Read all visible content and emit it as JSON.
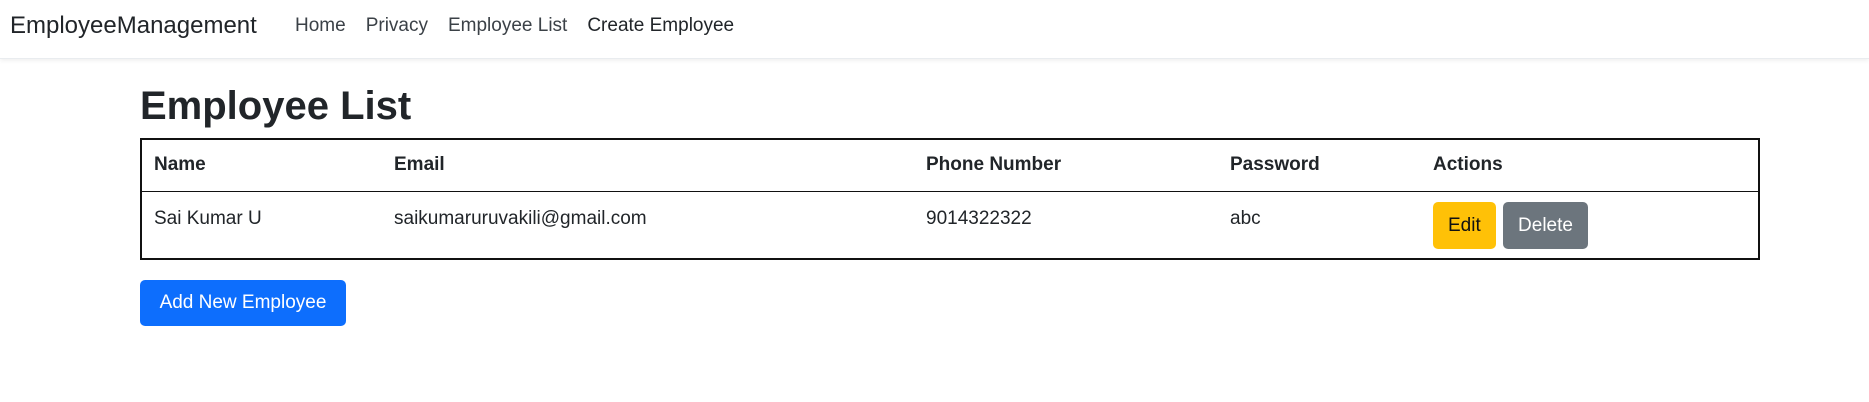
{
  "navbar": {
    "brand": "EmployeeManagement",
    "links": [
      "Home",
      "Privacy",
      "Employee List",
      "Create Employee"
    ]
  },
  "page": {
    "title": "Employee List"
  },
  "table": {
    "headers": [
      "Name",
      "Email",
      "Phone Number",
      "Password",
      "Actions"
    ],
    "rows": [
      {
        "name": "Sai Kumar U",
        "email": "saikumaruruvakili@gmail.com",
        "phone": "9014322322",
        "password": "abc",
        "edit_label": "Edit",
        "delete_label": "Delete"
      }
    ]
  },
  "add_button_label": "Add New Employee",
  "colors": {
    "primary": "#0d6efd",
    "warning": "#ffc107",
    "secondary": "#6c757d"
  }
}
